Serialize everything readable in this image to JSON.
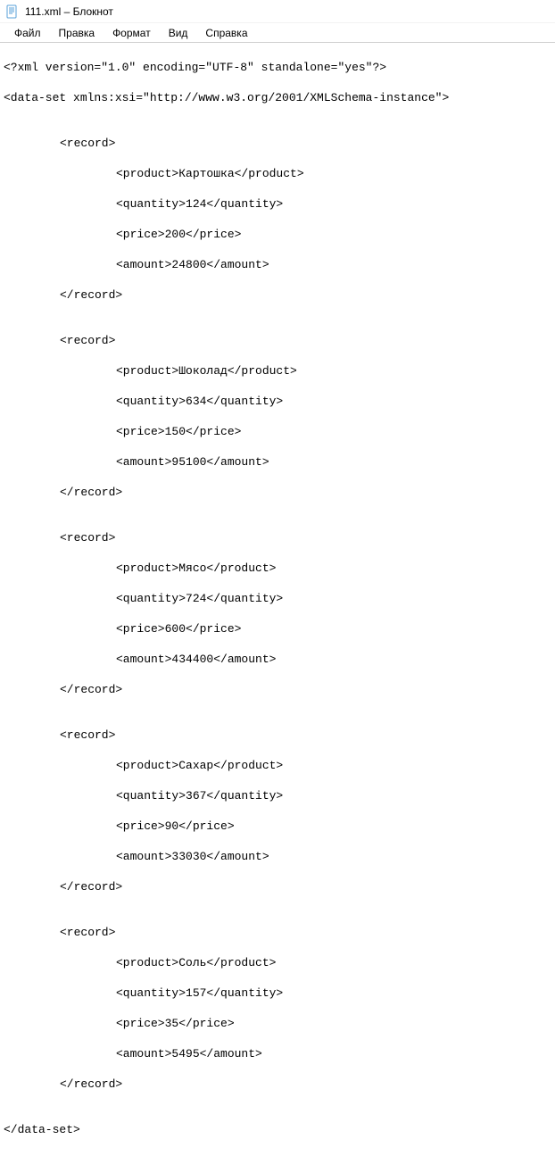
{
  "window": {
    "title": "111.xml – Блокнот"
  },
  "menu": {
    "file": "Файл",
    "edit": "Правка",
    "format": "Формат",
    "view": "Вид",
    "help": "Справка"
  },
  "xml": {
    "declaration": "<?xml version=\"1.0\" encoding=\"UTF-8\" standalone=\"yes\"?>",
    "root_open": "<data-set xmlns:xsi=\"http://www.w3.org/2001/XMLSchema-instance\">",
    "root_close": "</data-set>",
    "record_open": "<record>",
    "record_close": "</record>",
    "records": [
      {
        "product": "<product>Картошка</product>",
        "quantity": "<quantity>124</quantity>",
        "price": "<price>200</price>",
        "amount": "<amount>24800</amount>"
      },
      {
        "product": "<product>Шоколад</product>",
        "quantity": "<quantity>634</quantity>",
        "price": "<price>150</price>",
        "amount": "<amount>95100</amount>"
      },
      {
        "product": "<product>Мясо</product>",
        "quantity": "<quantity>724</quantity>",
        "price": "<price>600</price>",
        "amount": "<amount>434400</amount>"
      },
      {
        "product": "<product>Сахар</product>",
        "quantity": "<quantity>367</quantity>",
        "price": "<price>90</price>",
        "amount": "<amount>33030</amount>"
      },
      {
        "product": "<product>Соль</product>",
        "quantity": "<quantity>157</quantity>",
        "price": "<price>35</price>",
        "amount": "<amount>5495</amount>"
      }
    ]
  }
}
